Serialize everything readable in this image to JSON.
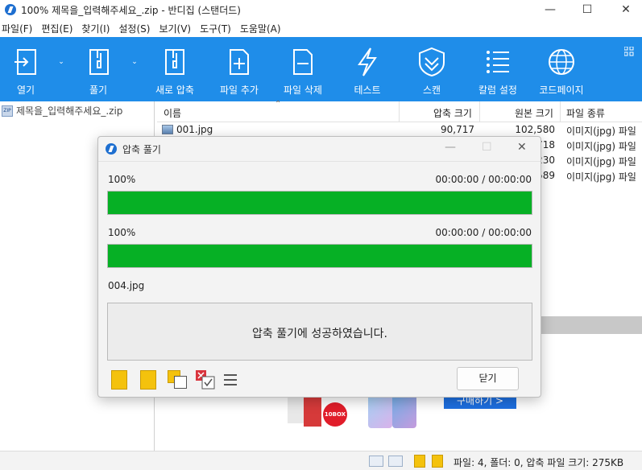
{
  "window": {
    "title": "100% 제목을_입력해주세요_.zip - 반디집 (스탠더드)",
    "minimize_glyph": "—",
    "maximize_glyph": "☐",
    "close_glyph": "✕"
  },
  "menu": [
    "파일(F)",
    "편집(E)",
    "찾기(I)",
    "설정(S)",
    "보기(V)",
    "도구(T)",
    "도움말(A)"
  ],
  "toolbar": {
    "background": "#1f8de9",
    "items": [
      {
        "label": "열기",
        "icon": "open-icon"
      },
      {
        "label": "풀기",
        "icon": "extract-icon"
      },
      {
        "label": "새로 압축",
        "icon": "new-archive-icon"
      },
      {
        "label": "파일 추가",
        "icon": "add-file-icon"
      },
      {
        "label": "파일 삭제",
        "icon": "delete-file-icon"
      },
      {
        "label": "테스트",
        "icon": "test-icon"
      },
      {
        "label": "스캔",
        "icon": "scan-icon"
      },
      {
        "label": "칼럼 설정",
        "icon": "column-settings-icon"
      },
      {
        "label": "코드페이지",
        "icon": "codepage-icon"
      }
    ],
    "dropdown_glyph": "⌄"
  },
  "tree": {
    "archive_name": "제목을_입력해주세요_.zip",
    "icon": "zip-icon",
    "icon_text": "ZIP"
  },
  "filelist": {
    "sort_glyph": "⌃",
    "columns": [
      "이름",
      "압축 크기",
      "원본 크기",
      "파일 종류"
    ],
    "rows": [
      {
        "name": "001.jpg",
        "compressed": "90,717",
        "original": "102,580",
        "type": "이미지(jpg) 파일"
      },
      {
        "name": "",
        "compressed": "",
        "original": "718",
        "type": "이미지(jpg) 파일"
      },
      {
        "name": "",
        "compressed": "",
        "original": "230",
        "type": "이미지(jpg) 파일"
      },
      {
        "name": "",
        "compressed": "",
        "original": "589",
        "type": "이미지(jpg) 파일"
      }
    ]
  },
  "ad": {
    "badge": "10BOX",
    "cta": "구매하기 >"
  },
  "statusbar": {
    "text": "파일: 4, 폴더: 0, 압축 파일 크기: 275KB"
  },
  "dialog": {
    "title": "압축 풀기",
    "minimize_glyph": "—",
    "maximize_glyph": "☐",
    "close_glyph": "✕",
    "progress1": {
      "percent_text": "100%",
      "time": "00:00:00 / 00:00:00",
      "fraction": 1.0
    },
    "progress2": {
      "percent_text": "100%",
      "time": "00:00:00 / 00:00:00",
      "fraction": 1.0
    },
    "current_file": "004.jpg",
    "message": "압축 풀기에 성공하였습니다.",
    "close_button": "닫기",
    "progress_color": "#06b025"
  }
}
